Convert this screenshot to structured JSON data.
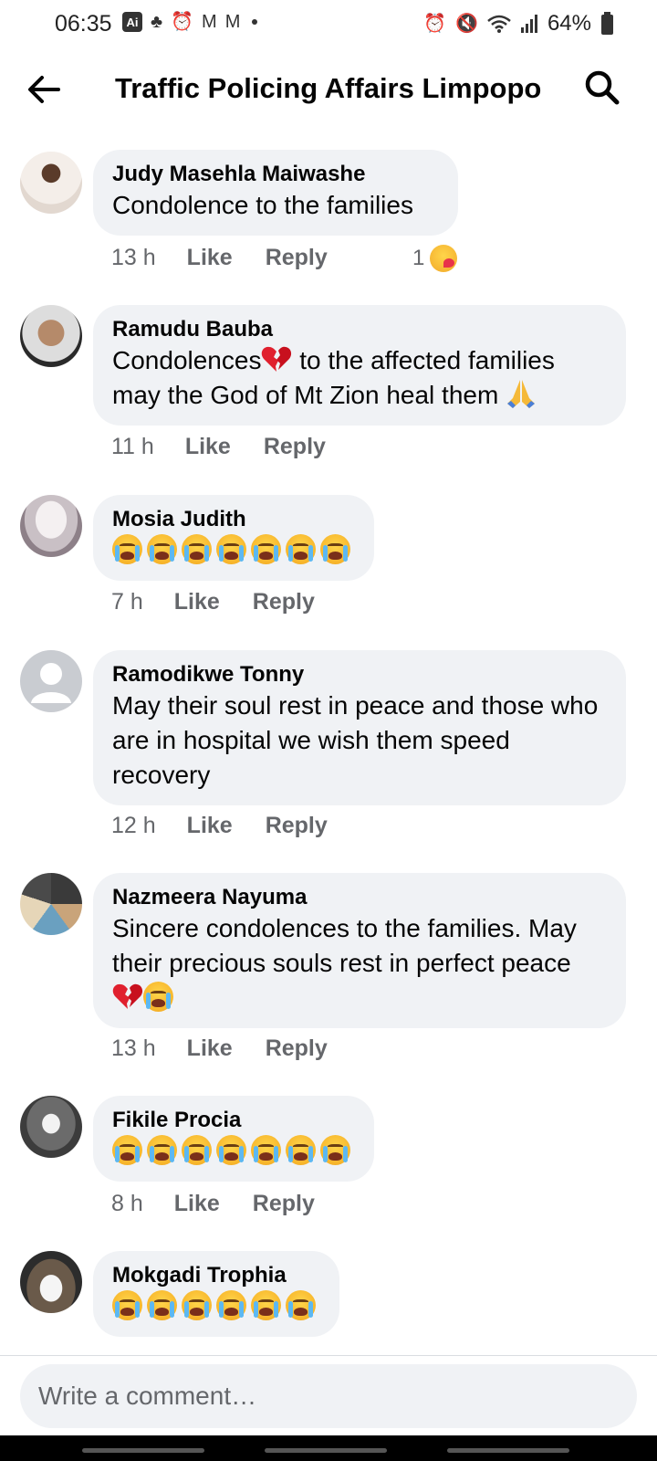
{
  "status": {
    "time": "06:35",
    "ai_badge": "Ai",
    "battery": "64%"
  },
  "header": {
    "title": "Traffic Policing Affairs Limpopo"
  },
  "comments": [
    {
      "author": "Judy Masehla Maiwashe",
      "text": "Condolence to the families",
      "time": "13 h",
      "like": "Like",
      "reply": "Reply",
      "reaction_count": "1"
    },
    {
      "author": "Ramudu Bauba",
      "text_a": "Condolences",
      "text_b": " to the affected families may the God of Mt Zion heal them ",
      "time": "11 h",
      "like": "Like",
      "reply": "Reply"
    },
    {
      "author": "Mosia Judith",
      "emoji": "crying-face x7",
      "time": "7 h",
      "like": "Like",
      "reply": "Reply"
    },
    {
      "author": "Ramodikwe Tonny",
      "text": "May their soul rest in peace  and those who are in hospital we wish them speed recovery",
      "time": "12 h",
      "like": "Like",
      "reply": "Reply"
    },
    {
      "author": "Nazmeera Nayuma",
      "text": "Sincere condolences to the families. May their precious souls rest in perfect peace",
      "time": "13 h",
      "like": "Like",
      "reply": "Reply"
    },
    {
      "author": "Fikile Procia",
      "emoji": "crying-face x7",
      "time": "8 h",
      "like": "Like",
      "reply": "Reply"
    },
    {
      "author": "Mokgadi Trophia",
      "emoji": "crying-face x6"
    }
  ],
  "composer": {
    "placeholder": "Write a comment…"
  },
  "colors": {
    "bubble": "#f0f2f5",
    "meta": "#65676b",
    "text": "#050505"
  }
}
